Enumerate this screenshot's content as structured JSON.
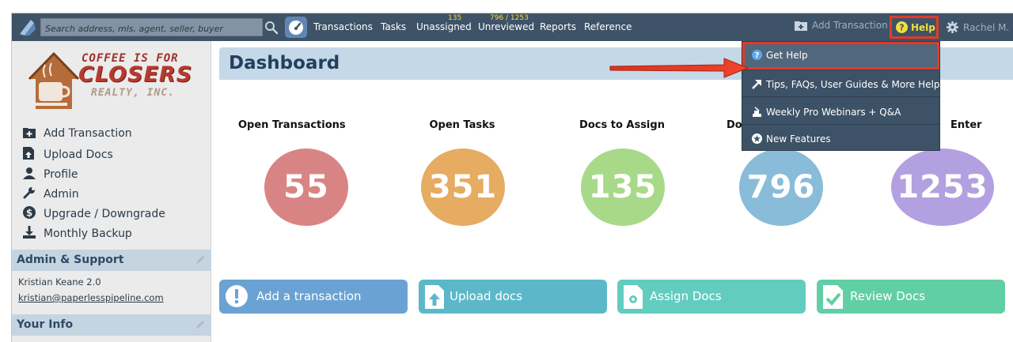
{
  "topbar": {
    "search_placeholder": "Search address, mls, agent, seller, buyer",
    "nav": {
      "transactions": "Transactions",
      "tasks": "Tasks",
      "unassigned": "Unassigned",
      "unassigned_count": "135",
      "unreviewed": "Unreviewed",
      "unreviewed_count": "796 / 1253",
      "reports": "Reports",
      "reference": "Reference"
    },
    "add_transaction": "Add Transaction",
    "help": "Help",
    "user": "Rachel M."
  },
  "help_menu": {
    "items": [
      {
        "label": "Get Help",
        "icon": "question-circle-icon"
      },
      {
        "label": "Tips, FAQs, User Guides & More Help",
        "icon": "arrow-icon"
      },
      {
        "label": "Weekly Pro Webinars + Q&A",
        "icon": "podium-icon"
      },
      {
        "label": "New Features",
        "icon": "star-icon"
      }
    ]
  },
  "sidebar": {
    "brand": {
      "line1": "COFFEE IS FOR",
      "line2": "CLOSERS",
      "line3": "REALTY, INC."
    },
    "links": [
      {
        "label": "Add Transaction",
        "icon": "add-folder-icon"
      },
      {
        "label": "Upload Docs",
        "icon": "upload-doc-icon"
      },
      {
        "label": "Profile",
        "icon": "user-icon"
      },
      {
        "label": "Admin",
        "icon": "wrench-icon"
      },
      {
        "label": "Upgrade / Downgrade",
        "icon": "dollar-icon"
      },
      {
        "label": "Monthly Backup",
        "icon": "download-icon"
      }
    ],
    "admin_support": {
      "title": "Admin & Support",
      "name": "Kristian Keane 2.0",
      "email": "kristian@paperlesspipeline.com"
    },
    "your_info": {
      "title": "Your Info"
    }
  },
  "dashboard": {
    "title": "Dashboard",
    "stats": [
      {
        "label": "Open Transactions",
        "value": "55",
        "color": "#d98484"
      },
      {
        "label": "Open Tasks",
        "value": "351",
        "color": "#e5ac62"
      },
      {
        "label": "Docs to Assign",
        "value": "135",
        "color": "#a7d989"
      },
      {
        "label": "Do",
        "value": "796",
        "color": "#89bcd9"
      },
      {
        "label": "Enter",
        "value": "1253",
        "color": "#b3a0e0"
      }
    ],
    "actions": [
      {
        "label": "Add a transaction",
        "color": "#6aa3d3"
      },
      {
        "label": "Upload docs",
        "color": "#5cb8c9"
      },
      {
        "label": "Assign Docs",
        "color": "#62cdbf"
      },
      {
        "label": "Review Docs",
        "color": "#61cfa6"
      }
    ]
  }
}
